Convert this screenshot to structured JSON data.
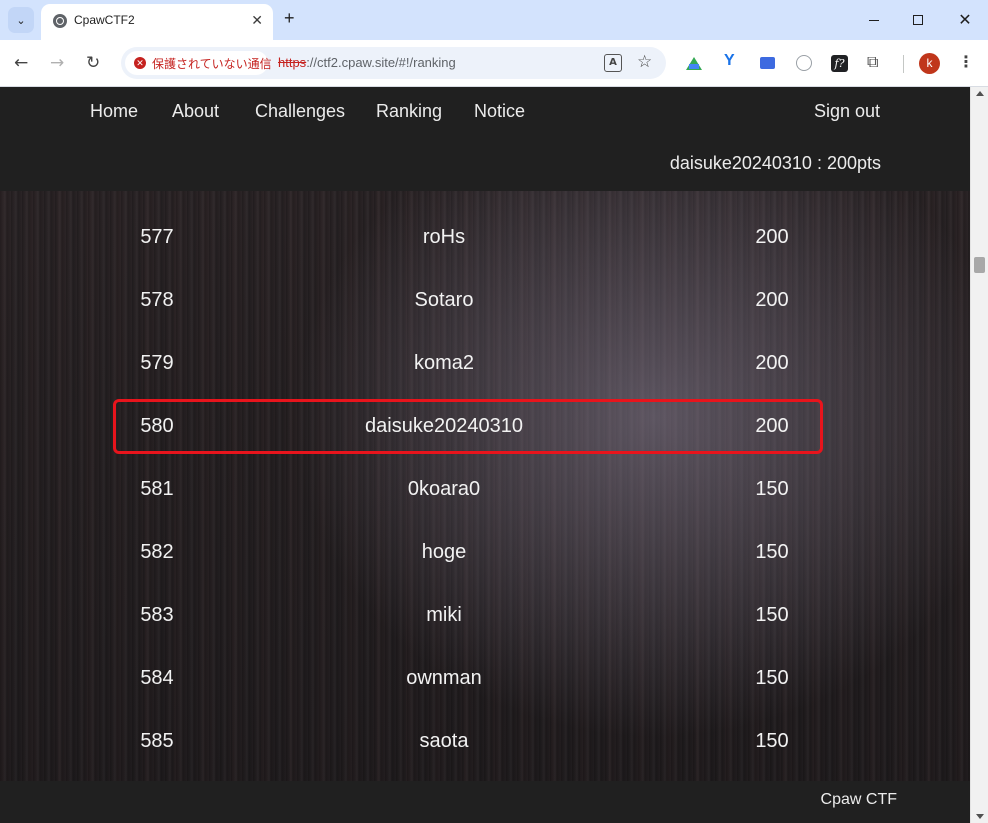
{
  "browser": {
    "tab_title": "CpawCTF2",
    "security_label": "保護されていない通信",
    "url_scheme": "https",
    "url_rest": "://ctf2.cpaw.site/#!/ranking",
    "avatar_letter": "k"
  },
  "site": {
    "nav": {
      "home": "Home",
      "about": "About",
      "challenges": "Challenges",
      "ranking": "Ranking",
      "notice": "Notice",
      "signout": "Sign out"
    },
    "user_score": "daisuke20240310 : 200pts",
    "footer": "Cpaw CTF"
  },
  "ranking": {
    "highlight_color": "#e8141c",
    "highlighted_rank": "580",
    "rows": [
      {
        "rank": "577",
        "name": "roHs",
        "score": "200"
      },
      {
        "rank": "578",
        "name": "Sotaro",
        "score": "200"
      },
      {
        "rank": "579",
        "name": "koma2",
        "score": "200"
      },
      {
        "rank": "580",
        "name": "daisuke20240310",
        "score": "200"
      },
      {
        "rank": "581",
        "name": "0koara0",
        "score": "150"
      },
      {
        "rank": "582",
        "name": "hoge",
        "score": "150"
      },
      {
        "rank": "583",
        "name": "miki",
        "score": "150"
      },
      {
        "rank": "584",
        "name": "ownman",
        "score": "150"
      },
      {
        "rank": "585",
        "name": "saota",
        "score": "150"
      }
    ]
  }
}
